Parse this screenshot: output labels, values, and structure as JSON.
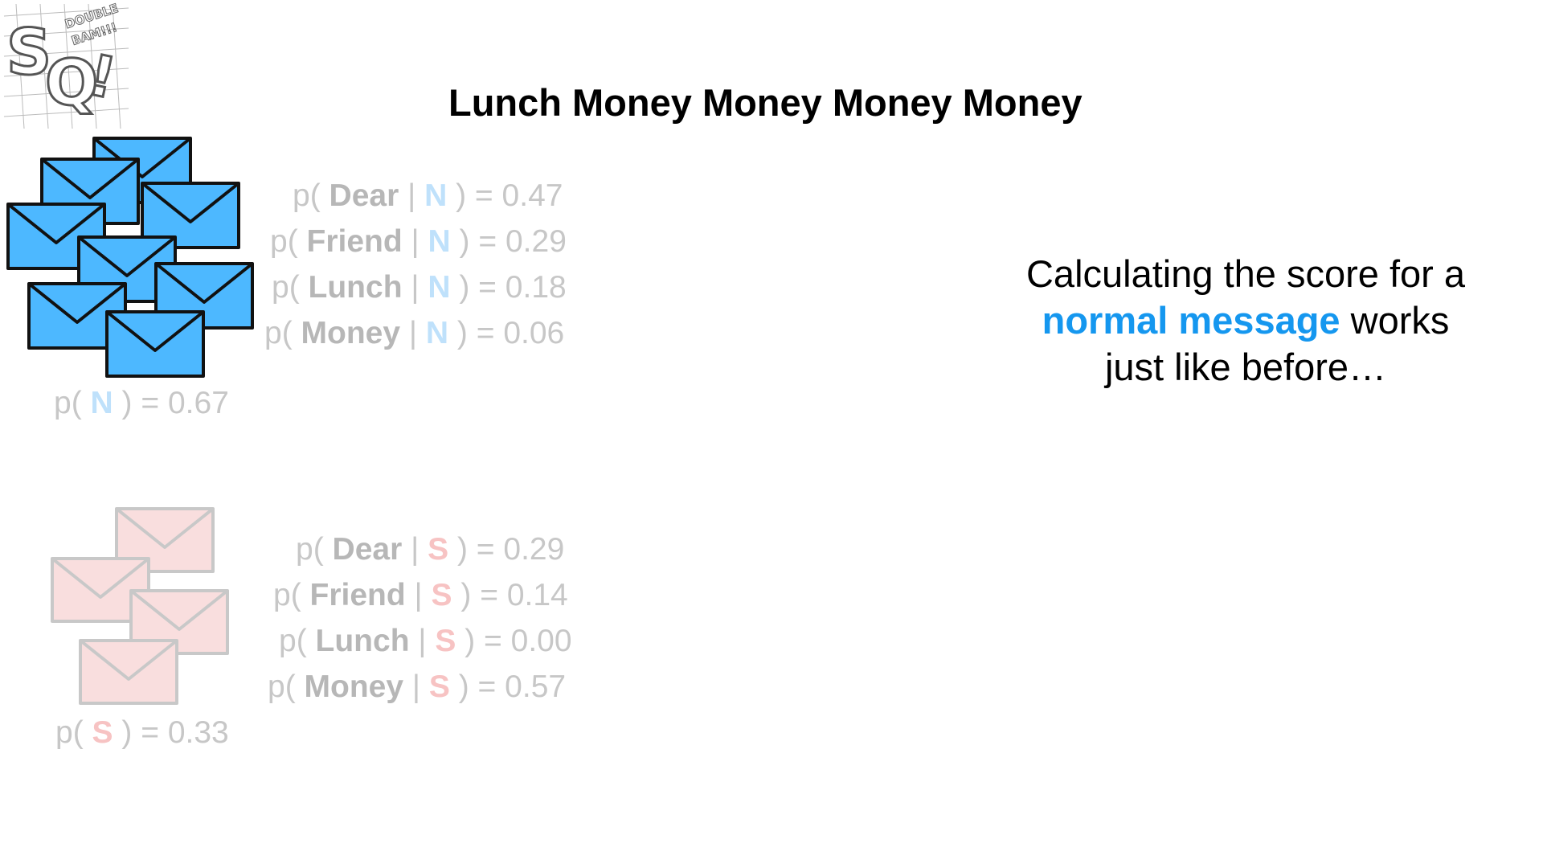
{
  "logo": {
    "text": "DOUBLE BAM!!! SQ!"
  },
  "title": "Lunch Money Money Money Money",
  "normal": {
    "class_label": "N",
    "prior_label": "p(",
    "prior_close": ") = 0.67",
    "color": "#4db8ff",
    "probs": [
      {
        "word": "Dear",
        "value": ") = 0.47"
      },
      {
        "word": "Friend",
        "value": ") = 0.29"
      },
      {
        "word": "Lunch",
        "value": ") = 0.18"
      },
      {
        "word": "Money",
        "value": ") = 0.06"
      }
    ]
  },
  "spam": {
    "class_label": "S",
    "prior_label": "p(",
    "prior_close": ") = 0.33",
    "color": "#f9dede",
    "probs": [
      {
        "word": "Dear",
        "value": ") = 0.29"
      },
      {
        "word": "Friend",
        "value": ") = 0.14"
      },
      {
        "word": "Lunch",
        "value": ") = 0.00"
      },
      {
        "word": "Money",
        "value": ") = 0.57"
      }
    ]
  },
  "narration": {
    "line1": "Calculating the score for a",
    "highlight": "normal message",
    "line2_rest": " works",
    "line3": "just like before…"
  },
  "common": {
    "p_open": "p(",
    "bar": "|"
  }
}
